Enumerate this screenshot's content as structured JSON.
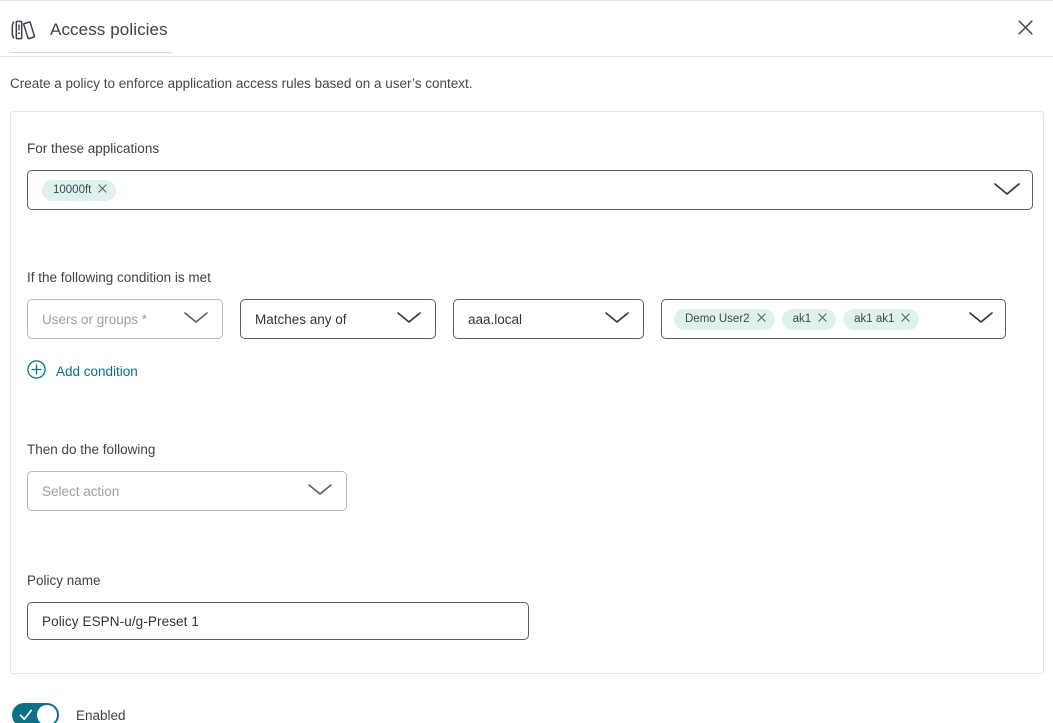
{
  "header": {
    "title": "Access policies",
    "icon": "books-icon",
    "close_icon": "close-icon"
  },
  "subtitle": "Create a policy to enforce application access rules based on a user’s context.",
  "sections": {
    "applications": {
      "label": "For these applications",
      "chips": [
        {
          "label": "10000ft",
          "remove_icon": "close-icon"
        }
      ],
      "chevron_icon": "chevron-down-icon"
    },
    "condition": {
      "label": "If the following condition is met",
      "subject": {
        "placeholder": "Users or groups *",
        "value": "",
        "chevron_icon": "chevron-down-icon"
      },
      "operator": {
        "value": "Matches any of",
        "chevron_icon": "chevron-down-icon"
      },
      "source": {
        "value": "aaa.local",
        "chevron_icon": "chevron-down-icon"
      },
      "values": {
        "chips": [
          {
            "label": "Demo User2",
            "remove_icon": "close-icon"
          },
          {
            "label": "ak1",
            "remove_icon": "close-icon"
          },
          {
            "label": "ak1 ak1",
            "remove_icon": "close-icon"
          }
        ],
        "chevron_icon": "chevron-down-icon"
      },
      "add_condition": {
        "label": "Add condition",
        "icon": "plus-circle-icon"
      }
    },
    "action": {
      "label": "Then do the following",
      "select": {
        "placeholder": "Select action",
        "value": "",
        "chevron_icon": "chevron-down-icon"
      }
    },
    "policy_name": {
      "label": "Policy name",
      "value": "Policy ESPN-u/g-Preset 1",
      "placeholder": "Policy name"
    }
  },
  "footer": {
    "toggle": {
      "label": "Enabled",
      "state": "on",
      "icon": "check-icon"
    }
  },
  "colors": {
    "accent": "#067282",
    "toggle_on": "#0d7186",
    "chip_bg": "#ddf1ef",
    "text": "#3c424b",
    "placeholder": "#9aa0a6",
    "border": "#5c6066",
    "border_soft": "#b6babf",
    "card_border": "#e2e4e7"
  }
}
